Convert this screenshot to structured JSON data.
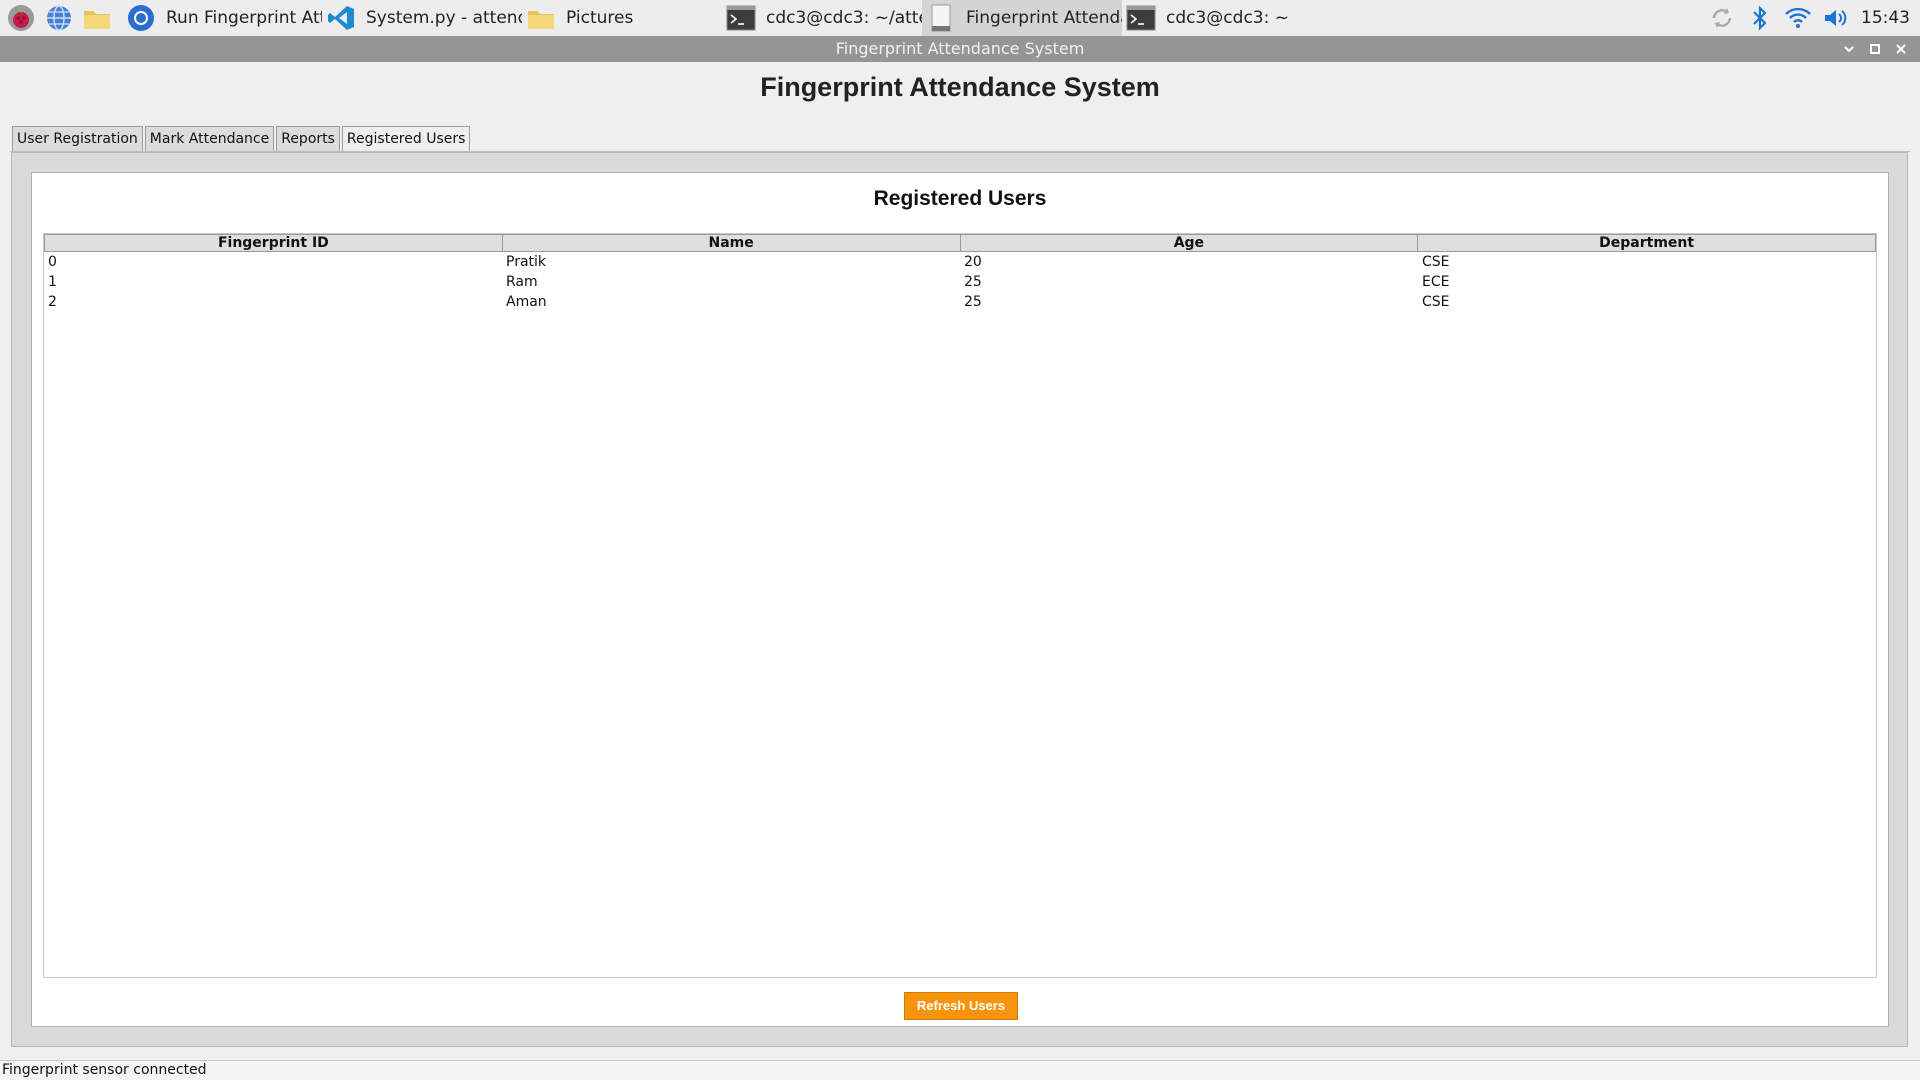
{
  "taskbar": {
    "launchers": [
      {
        "icon": "raspberry-menu-icon"
      },
      {
        "icon": "web-browser-globe-icon"
      },
      {
        "icon": "file-manager-folder-icon"
      }
    ],
    "tasks": [
      {
        "label": "Run Fingerprint Atte..",
        "icon": "chromium-icon",
        "active": false
      },
      {
        "label": "System.py - attenda..",
        "icon": "vscode-icon",
        "active": false
      },
      {
        "label": "Pictures",
        "icon": "folder-icon",
        "active": false
      },
      {
        "label": "cdc3@cdc3: ~/atten..",
        "icon": "terminal-icon",
        "active": false
      },
      {
        "label": "Fingerprint Attendan..",
        "icon": "app-window-icon",
        "active": true
      },
      {
        "label": "cdc3@cdc3: ~",
        "icon": "terminal-icon",
        "active": false
      }
    ],
    "tray": {
      "clock": "15:43"
    }
  },
  "window": {
    "title": "Fingerprint Attendance System"
  },
  "app": {
    "heading": "Fingerprint Attendance System",
    "tabs": [
      "User Registration",
      "Mark Attendance",
      "Reports",
      "Registered Users"
    ],
    "active_tab": "Registered Users",
    "panel_title": "Registered Users",
    "table": {
      "headers": [
        "Fingerprint ID",
        "Name",
        "Age",
        "Department"
      ],
      "rows": [
        [
          "0",
          "Pratik",
          "20",
          "CSE"
        ],
        [
          "1",
          "Ram",
          "25",
          "ECE"
        ],
        [
          "2",
          "Aman",
          "25",
          "CSE"
        ]
      ]
    },
    "refresh_label": "Refresh Users",
    "status": "Fingerprint sensor connected"
  },
  "colors": {
    "accent_button": "#f7940d",
    "titlebar": "#959595"
  }
}
